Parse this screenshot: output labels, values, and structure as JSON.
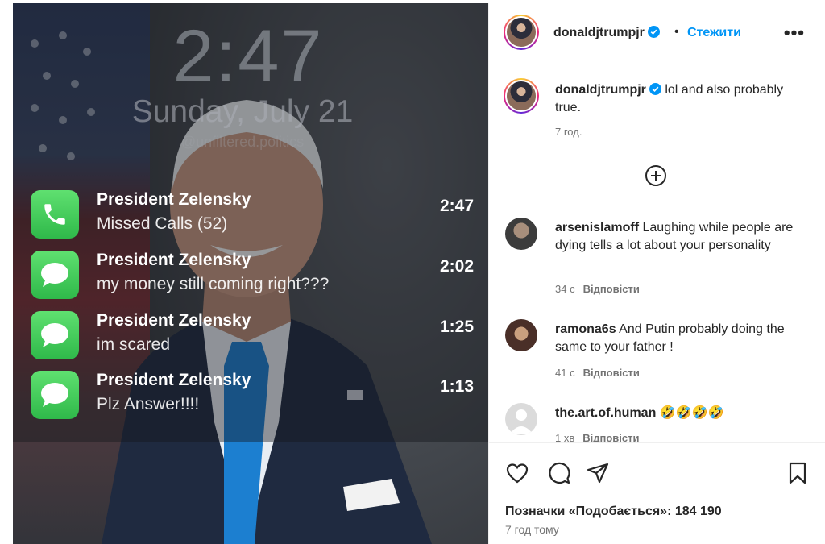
{
  "lock_screen": {
    "time": "2:47",
    "date": "Sunday, July 21",
    "watermark": "@unfiltered.politics"
  },
  "notifications": [
    {
      "app": "phone-icon",
      "sender": "President Zelensky",
      "message": "Missed Calls (52)",
      "time": "2:47"
    },
    {
      "app": "messages-icon",
      "sender": "President Zelensky",
      "message": "my money still coming right???",
      "time": "2:02"
    },
    {
      "app": "messages-icon",
      "sender": "President Zelensky",
      "message": "im scared",
      "time": "1:25"
    },
    {
      "app": "messages-icon",
      "sender": "President Zelensky",
      "message": "Plz Answer!!!!",
      "time": "1:13"
    }
  ],
  "post": {
    "username": "donaldjtrumpjr",
    "follow_label": "Стежити",
    "separator": "•",
    "more_label": "•••",
    "caption_text": "lol and also probably true.",
    "caption_time": "7 год.",
    "likes_label": "Позначки «Подобається»: 184 190",
    "posted_ago": "7 год тому"
  },
  "comments": [
    {
      "username": "arsenislamoff",
      "text": "Laughing while people are dying tells a lot about your personality",
      "time": "34 с",
      "reply_label": "Відповісти"
    },
    {
      "username": "ramona6s",
      "text": "And Putin probably doing the same to your father !",
      "time": "41 с",
      "reply_label": "Відповісти"
    },
    {
      "username": "the.art.of.human",
      "text": "🤣🤣🤣🤣",
      "time": "1 хв",
      "reply_label": "Відповісти"
    }
  ],
  "colors": {
    "accent": "#0095f6",
    "verified": "#0095f6",
    "muted_text": "#737373",
    "ios_green": "#34c759"
  }
}
